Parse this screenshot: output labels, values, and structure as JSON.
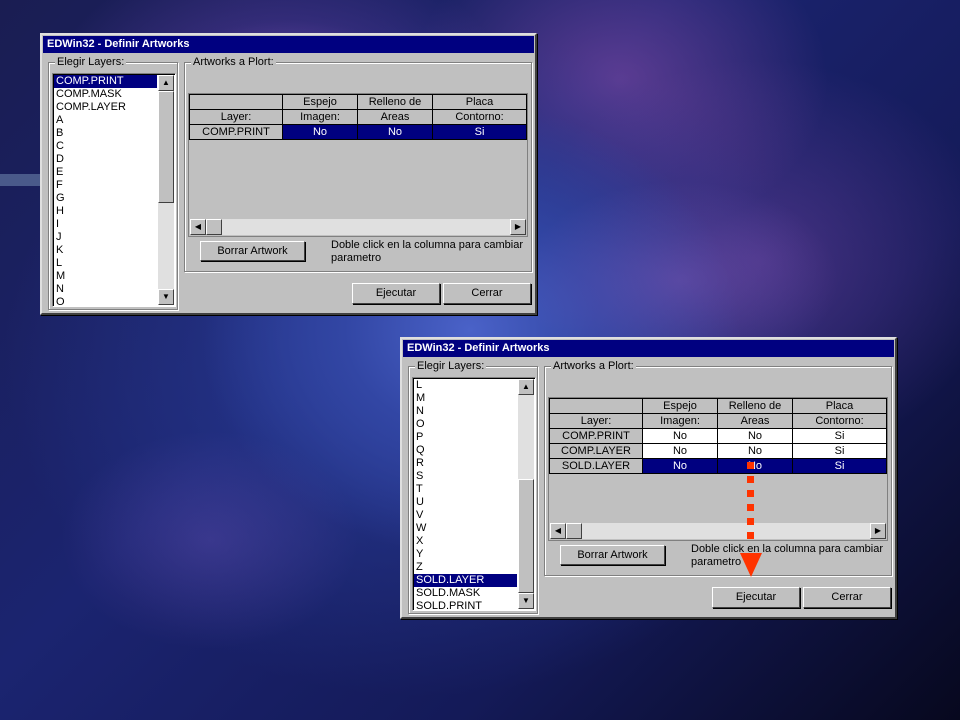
{
  "window1": {
    "title": "EDWin32 - Definir Artworks",
    "layers_group_label": "Elegir Layers:",
    "layers": [
      "COMP.PRINT",
      "COMP.MASK",
      "COMP.LAYER",
      "A",
      "B",
      "C",
      "D",
      "E",
      "F",
      "G",
      "H",
      "I",
      "J",
      "K",
      "L",
      "M",
      "N",
      "O"
    ],
    "selected_layer": "COMP.PRINT",
    "artworks_group_label": "Artworks a Plort:",
    "grid_headers_row1": [
      "",
      "Espejo",
      "Relleno de",
      "Placa"
    ],
    "grid_headers_row2": [
      "Layer:",
      "Imagen:",
      "Areas",
      "Contorno:"
    ],
    "rows": [
      {
        "layer": "COMP.PRINT",
        "espejo": "No",
        "relleno": "No",
        "placa": "Si",
        "selected": true
      }
    ],
    "borrar_button": "Borrar Artwork",
    "hint_line1": "Doble click en la columna para cambiar",
    "hint_line2": "parametro",
    "ejecutar_button": "Ejecutar",
    "cerrar_button": "Cerrar"
  },
  "window2": {
    "title": "EDWin32 - Definir Artworks",
    "layers_group_label": "Elegir Layers:",
    "layers": [
      "L",
      "M",
      "N",
      "O",
      "P",
      "Q",
      "R",
      "S",
      "T",
      "U",
      "V",
      "W",
      "X",
      "Y",
      "Z",
      "SOLD.LAYER",
      "SOLD.MASK",
      "SOLD.PRINT"
    ],
    "selected_layer": "SOLD.LAYER",
    "artworks_group_label": "Artworks a Plort:",
    "grid_headers_row1": [
      "",
      "Espejo",
      "Relleno de",
      "Placa"
    ],
    "grid_headers_row2": [
      "Layer:",
      "Imagen:",
      "Areas",
      "Contorno:"
    ],
    "rows": [
      {
        "layer": "COMP.PRINT",
        "espejo": "No",
        "relleno": "No",
        "placa": "Si",
        "selected": false
      },
      {
        "layer": "COMP.LAYER",
        "espejo": "No",
        "relleno": "No",
        "placa": "Si",
        "selected": false
      },
      {
        "layer": "SOLD.LAYER",
        "espejo": "No",
        "relleno": "No",
        "placa": "Si",
        "selected": true
      }
    ],
    "borrar_button": "Borrar Artwork",
    "hint_line1": "Doble click en la columna para cambiar",
    "hint_line2": "parametro",
    "ejecutar_button": "Ejecutar",
    "cerrar_button": "Cerrar"
  },
  "colors": {
    "selection": "#000080",
    "arrow": "#ff3300"
  }
}
